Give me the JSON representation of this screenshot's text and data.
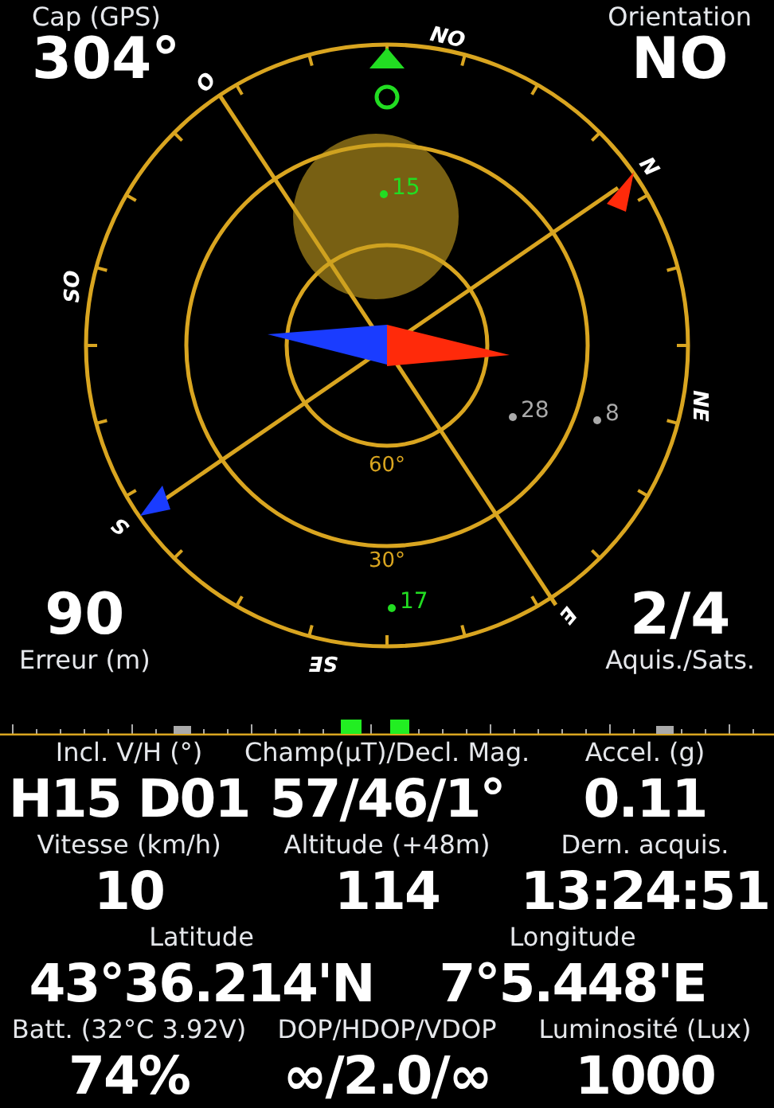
{
  "heading": {
    "label": "Cap (GPS)",
    "value": "304°"
  },
  "orientation": {
    "label": "Orientation",
    "value": "NO"
  },
  "error": {
    "value": "90",
    "label": "Erreur (m)"
  },
  "satellites_count": {
    "value": "2/4",
    "label": "Aquis./Sats."
  },
  "compass": {
    "cardinals": [
      "NO",
      "O",
      "N",
      "SO",
      "NE",
      "S",
      "E",
      "SE"
    ],
    "rings": [
      "60°",
      "30°"
    ],
    "satellites": [
      {
        "label": "15",
        "color": "#22dd22"
      },
      {
        "label": "17",
        "color": "#22dd22"
      },
      {
        "label": "28",
        "color": "#aaaaaa"
      },
      {
        "label": "8",
        "color": "#aaaaaa"
      }
    ]
  },
  "readings": [
    {
      "label": "Incl. V/H (°)",
      "value": "H15 D01"
    },
    {
      "label": "Champ(µT)/Decl. Mag.",
      "value": "57/46/1°"
    },
    {
      "label": "Accel. (g)",
      "value": "0.11"
    },
    {
      "label": "Vitesse (km/h)",
      "value": "10"
    },
    {
      "label": "Altitude (+48m)",
      "value": "114"
    },
    {
      "label": "Dern. acquis.",
      "value": "13:24:51"
    }
  ],
  "position": [
    {
      "label": "Latitude",
      "value": "43°36.214'N"
    },
    {
      "label": "Longitude",
      "value": "7°5.448'E"
    }
  ],
  "status": [
    {
      "label": "Batt. (32°C 3.92V)",
      "value": "74%"
    },
    {
      "label": "DOP/HDOP/VDOP",
      "value": "∞/2.0/∞"
    },
    {
      "label": "Luminosité (Lux)",
      "value": "1000"
    }
  ]
}
